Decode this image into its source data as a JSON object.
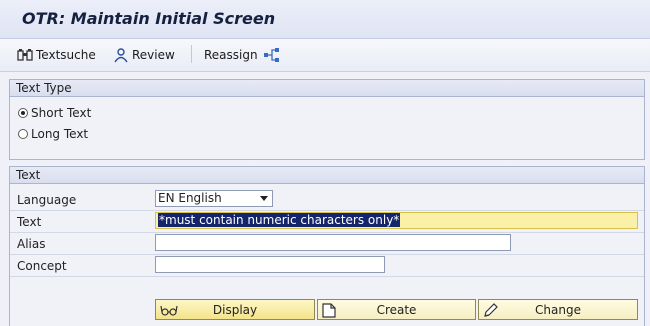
{
  "window": {
    "title": "OTR: Maintain Initial Screen"
  },
  "toolbar": {
    "textsuche": "Textsuche",
    "review": "Review",
    "reassign": "Reassign"
  },
  "text_type": {
    "header": "Text Type",
    "options": [
      {
        "label": "Short Text",
        "selected": true
      },
      {
        "label": "Long Text",
        "selected": false
      }
    ]
  },
  "text_group": {
    "header": "Text",
    "language_label": "Language",
    "language_value": "EN English",
    "text_label": "Text",
    "text_value": "*must contain numeric characters only*",
    "alias_label": "Alias",
    "alias_value": "",
    "concept_label": "Concept",
    "concept_value": ""
  },
  "buttons": {
    "display": "Display",
    "create": "Create",
    "change": "Change"
  }
}
